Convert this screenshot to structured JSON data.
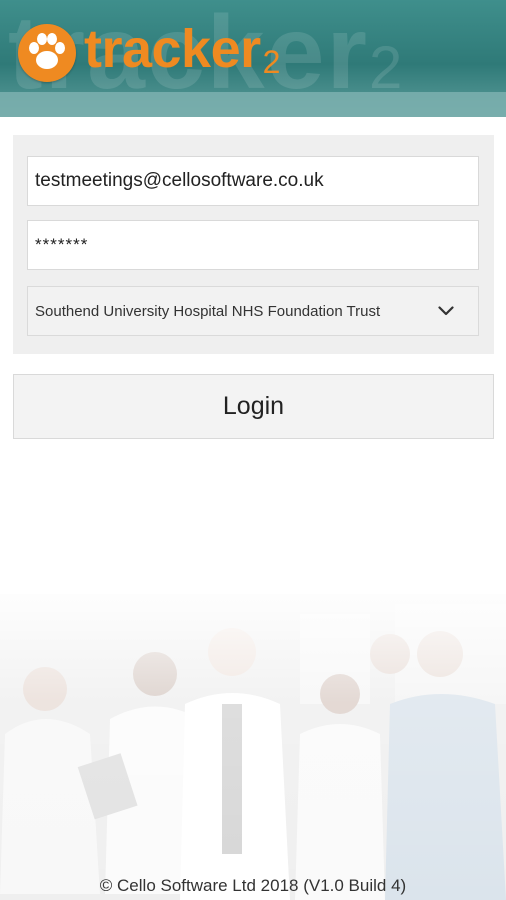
{
  "header": {
    "brand": "tracker",
    "brand_suffix": "2",
    "watermark": "tracker",
    "watermark_suffix": "2",
    "logo_icon": "paw-icon",
    "accent_color": "#ef8a21",
    "header_color": "#2f7a78"
  },
  "form": {
    "email_value": "testmeetings@cellosoftware.co.uk",
    "password_value": "*******",
    "trust_selected": "Southend University Hospital NHS Foundation Trust",
    "dropdown_icon": "chevron-down-icon"
  },
  "login_label": "Login",
  "footer": {
    "copyright": "© Cello Software Ltd 2018  (V1.0 Build 4)"
  }
}
